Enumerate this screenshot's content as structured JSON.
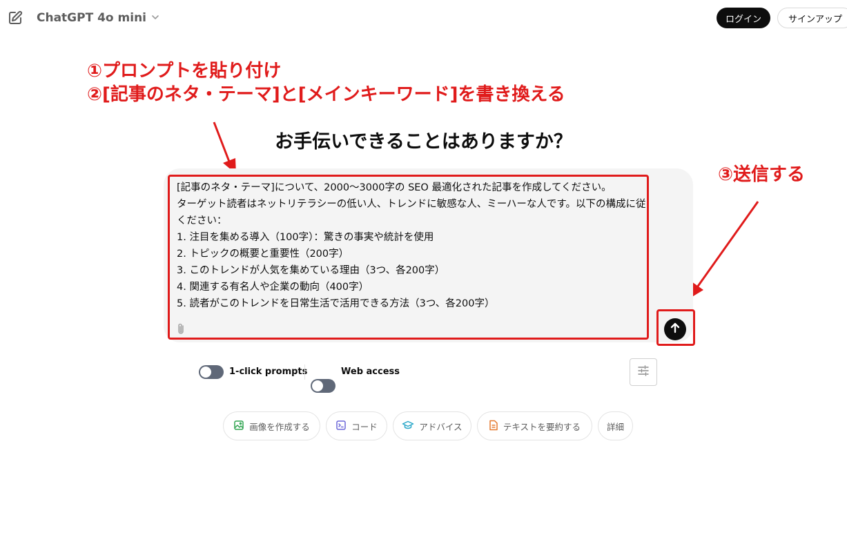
{
  "header": {
    "model_name": "ChatGPT 4o mini",
    "login_label": "ログイン",
    "signup_label": "サインアップ"
  },
  "annotations": {
    "step1": "①プロンプトを貼り付け",
    "step2": "②[記事のネタ・テーマ]と[メインキーワード]を書き換える",
    "step3": "③送信する"
  },
  "main": {
    "heading": "お手伝いできることはありますか？"
  },
  "composer": {
    "prompt_text": "[記事のネタ・テーマ]について、2000〜3000字の SEO 最適化された記事を作成してください。\nターゲット読者はネットリテラシーの低い人、トレンドに敏感な人、ミーハーな人です。以下の構成に従ってください：\n1. 注目を集める導入（100字）：驚きの事実や統計を使用\n2. トピックの概要と重要性（200字）\n3. このトレンドが人気を集めている理由（3つ、各200字）\n4. 関連する有名人や企業の動向（400字）\n5. 読者がこのトレンドを日常生活で活用できる方法（3つ、各200字）"
  },
  "options": {
    "toggle1_label": "1-click prompts",
    "toggle2_label": "Web access"
  },
  "chips": {
    "image": "画像を作成する",
    "code": "コード",
    "advice": "アドバイス",
    "summarize": "テキストを要約する",
    "more": "詳細"
  },
  "colors": {
    "annotation": "#e01b1b",
    "composer_bg": "#f4f4f4",
    "toggle_off": "#5f6878",
    "chip_image": "#2ea44f",
    "chip_code": "#6b67d8",
    "chip_advice": "#2aa7c9",
    "chip_summarize": "#e5782d"
  },
  "icons": {
    "new_chat": "edit-icon",
    "model_dropdown": "chevron-down-icon",
    "attach": "paperclip-icon",
    "send": "arrow-up-icon",
    "settings": "sliders-icon"
  }
}
